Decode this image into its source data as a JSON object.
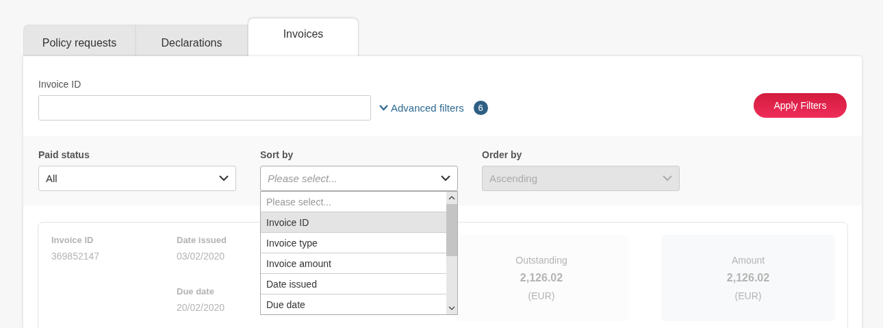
{
  "tabs": [
    {
      "label": "Policy requests",
      "selected": false
    },
    {
      "label": "Declarations",
      "selected": false
    },
    {
      "label": "Invoices",
      "selected": true
    }
  ],
  "invoice_id": {
    "label": "Invoice ID"
  },
  "advanced_filters": {
    "label": "Advanced filters",
    "count": "6",
    "expanded": false
  },
  "apply_button": "Apply Filters",
  "filters": [
    {
      "label": "Paid status",
      "value": "All",
      "disabled": false,
      "open": false
    },
    {
      "label": "Sort by",
      "placeholder": "Please select...",
      "disabled": false,
      "open": true,
      "options": [
        {
          "label": "Please select...",
          "kind": "placeholder",
          "selected": false
        },
        {
          "label": "Invoice ID",
          "kind": "option",
          "selected": true
        },
        {
          "label": "Invoice type",
          "kind": "option",
          "selected": false
        },
        {
          "label": "Invoice amount",
          "kind": "option",
          "selected": false
        },
        {
          "label": "Date issued",
          "kind": "option",
          "selected": false
        },
        {
          "label": "Due date",
          "kind": "option",
          "selected": false
        }
      ]
    },
    {
      "label": "Order by",
      "value": "Ascending",
      "disabled": true,
      "open": false
    }
  ],
  "invoice_card": {
    "fields": [
      {
        "label": "Invoice ID",
        "value": "369852147"
      },
      {
        "label": "Date issued",
        "value": "03/02/2020"
      },
      {
        "label": "Due date",
        "value": "20/02/2020"
      }
    ],
    "tiles": [
      {
        "label": "Outstanding",
        "value": "2,126.02",
        "currency": "(EUR)"
      },
      {
        "label": "Amount",
        "value": "2,126.02",
        "currency": "(EUR)"
      }
    ]
  }
}
